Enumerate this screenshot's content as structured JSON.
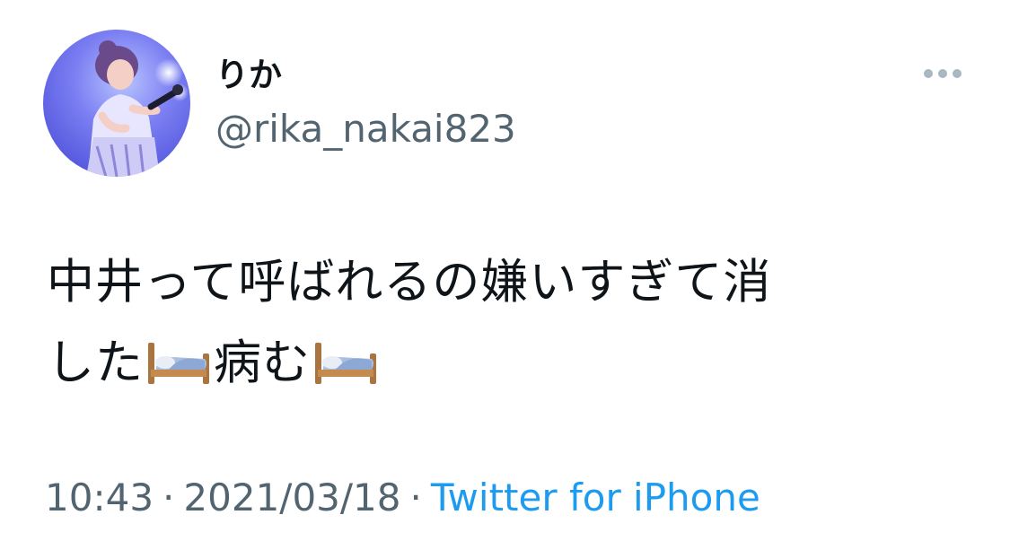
{
  "tweet": {
    "author": {
      "display_name": "りか",
      "handle": "@rika_nakai823"
    },
    "text_line1": "中井って呼ばれるの嫌いすぎて消",
    "text_line2_part1": "した",
    "text_line2_part2": "病む",
    "emoji_name": "bed-emoji",
    "time": "10:43",
    "date": "2021/03/18",
    "separator": "·",
    "source": "Twitter for iPhone"
  },
  "colors": {
    "text": "#0f1419",
    "secondary": "#536471",
    "link": "#1d9bf0",
    "background": "#ffffff"
  }
}
